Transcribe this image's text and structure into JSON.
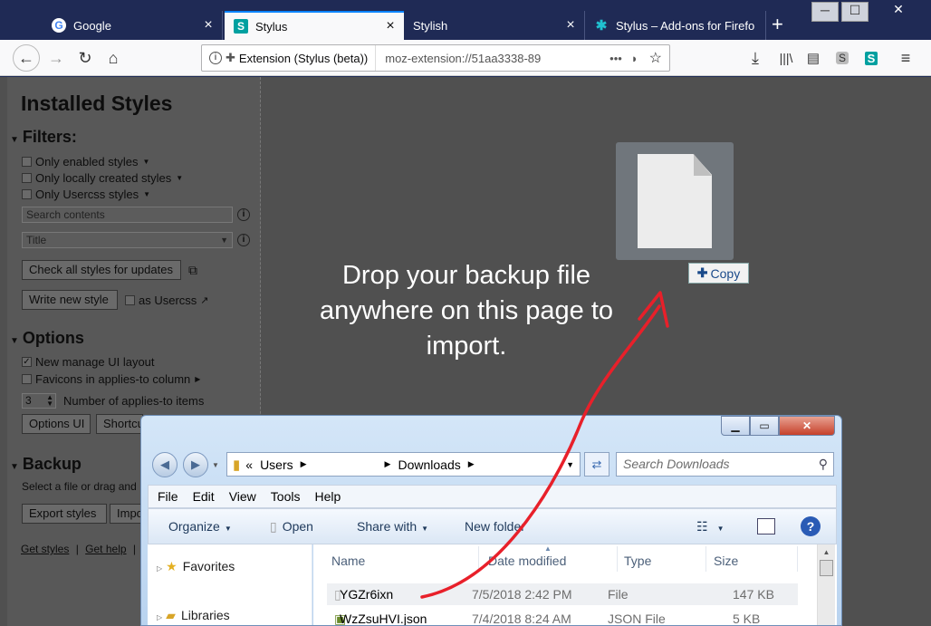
{
  "tabs": [
    {
      "title": "Google",
      "close": "×"
    },
    {
      "title": "Stylus",
      "close": "×"
    },
    {
      "title": "Stylish",
      "close": "×"
    },
    {
      "title": "Stylus – Add-ons for Firefo",
      "close": "×"
    }
  ],
  "new_tab": "+",
  "window_controls": {
    "minimize": "─",
    "maximize": "☐",
    "close": "✕"
  },
  "urlbar": {
    "identity": "Extension (Stylus (beta))",
    "url": "moz-extension://51aa3338-89",
    "more": "•••"
  },
  "sidebar": {
    "title": "Installed Styles",
    "filters": {
      "heading": "Filters:",
      "items": [
        "Only enabled styles",
        "Only locally created styles",
        "Only Usercss styles"
      ],
      "search_placeholder": "Search contents",
      "sort_value": "Title"
    },
    "check_updates": "Check all styles for updates",
    "write_new": "Write new style",
    "as_usercss": "as Usercss",
    "options": {
      "heading": "Options",
      "new_layout": "New manage UI layout",
      "favicons": "Favicons in applies-to column",
      "applies_count": "3",
      "applies_label": "Number of applies-to items",
      "options_ui": "Options UI",
      "shortcuts": "Shortcu"
    },
    "backup": {
      "heading": "Backup",
      "hint": "Select a file or drag and",
      "export": "Export styles",
      "import": "Impo"
    },
    "links": {
      "get_styles": "Get styles",
      "sep": "|",
      "get_help": "Get help",
      "sep2": "|"
    }
  },
  "drop_hint": "Drop your backup file anywhere on this page to import.",
  "copy_badge": "Copy",
  "explorer": {
    "path": [
      "«",
      "Users",
      "Downloads"
    ],
    "search_placeholder": "Search Downloads",
    "menu": [
      "File",
      "Edit",
      "View",
      "Tools",
      "Help"
    ],
    "commands": {
      "organize": "Organize",
      "open": "Open",
      "share": "Share with",
      "new_folder": "New folder"
    },
    "nav": [
      "Favorites",
      "Libraries"
    ],
    "columns": [
      "Name",
      "Date modified",
      "Type",
      "Size"
    ],
    "files": [
      {
        "name": "YGZr6ixn",
        "date": "7/5/2018 2:42 PM",
        "type": "File",
        "size": "147 KB"
      },
      {
        "name": "WzZsuHVI.json",
        "date": "7/4/2018 8:24 AM",
        "type": "JSON File",
        "size": "5 KB"
      }
    ]
  },
  "colors": {
    "accent": "#0a84ff",
    "arrow": "#e8202a",
    "tabstrip": "#1f2a55",
    "page_bg": "#505050"
  }
}
